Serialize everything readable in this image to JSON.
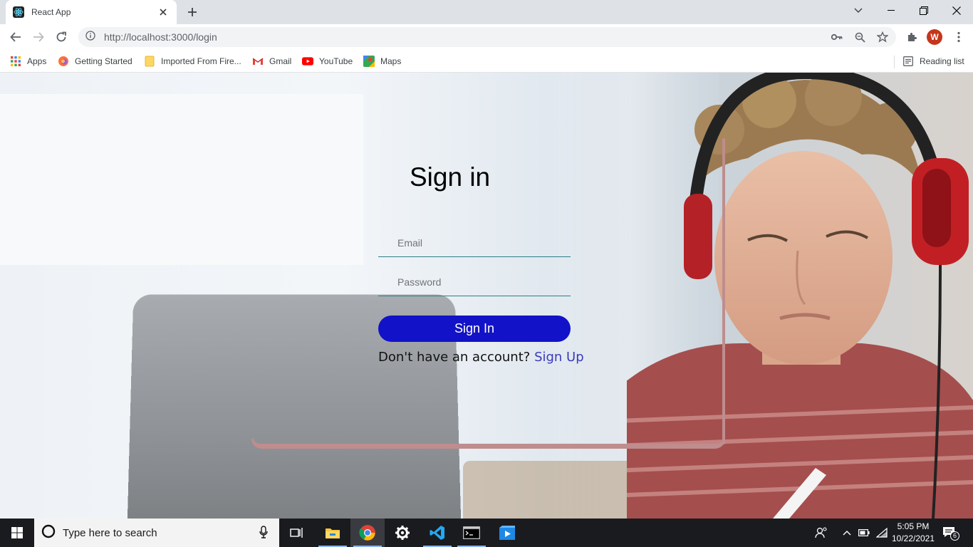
{
  "browser": {
    "tab_title": "React App",
    "url": "http://localhost:3000/login",
    "profile_initial": "W"
  },
  "bookmarks": {
    "items": [
      {
        "label": "Apps",
        "icon": "apps-grid-icon"
      },
      {
        "label": "Getting Started",
        "icon": "firefox-icon"
      },
      {
        "label": "Imported From Fire...",
        "icon": "folder-icon"
      },
      {
        "label": "Gmail",
        "icon": "gmail-icon"
      },
      {
        "label": "YouTube",
        "icon": "youtube-icon"
      },
      {
        "label": "Maps",
        "icon": "maps-icon"
      }
    ],
    "reading_list": "Reading list"
  },
  "login": {
    "title": "Sign in",
    "email_placeholder": "Email",
    "password_placeholder": "Password",
    "submit_label": "Sign In",
    "no_account_text": "Don't have an account?",
    "signup_link": "Sign Up"
  },
  "taskbar": {
    "search_placeholder": "Type here to search",
    "time": "5:05 PM",
    "date": "10/22/2021",
    "notification_count": "6"
  },
  "colors": {
    "accent_button": "#1212c8",
    "card_border": "#bf8d8d",
    "input_underline": "#2a7f86",
    "signup_link": "#3b3bb8"
  }
}
